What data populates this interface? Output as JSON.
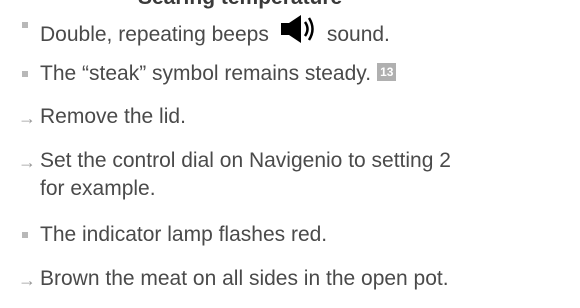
{
  "heading_partial": "Searing temperature",
  "steps": [
    {
      "kind": "result",
      "before": "Double, repeating beeps",
      "icon": "speaker-icon",
      "after": "sound."
    },
    {
      "kind": "result",
      "text": "The “steak” symbol remains steady.",
      "ref": "13"
    },
    {
      "kind": "action",
      "text": "Remove the lid."
    },
    {
      "kind": "action",
      "line1": "Set the control dial on Navigenio to setting 2",
      "line2": "for example."
    },
    {
      "kind": "result",
      "text": "The indicator lamp flashes red."
    },
    {
      "kind": "action",
      "text": "Brown the meat on all sides in the open pot."
    }
  ]
}
